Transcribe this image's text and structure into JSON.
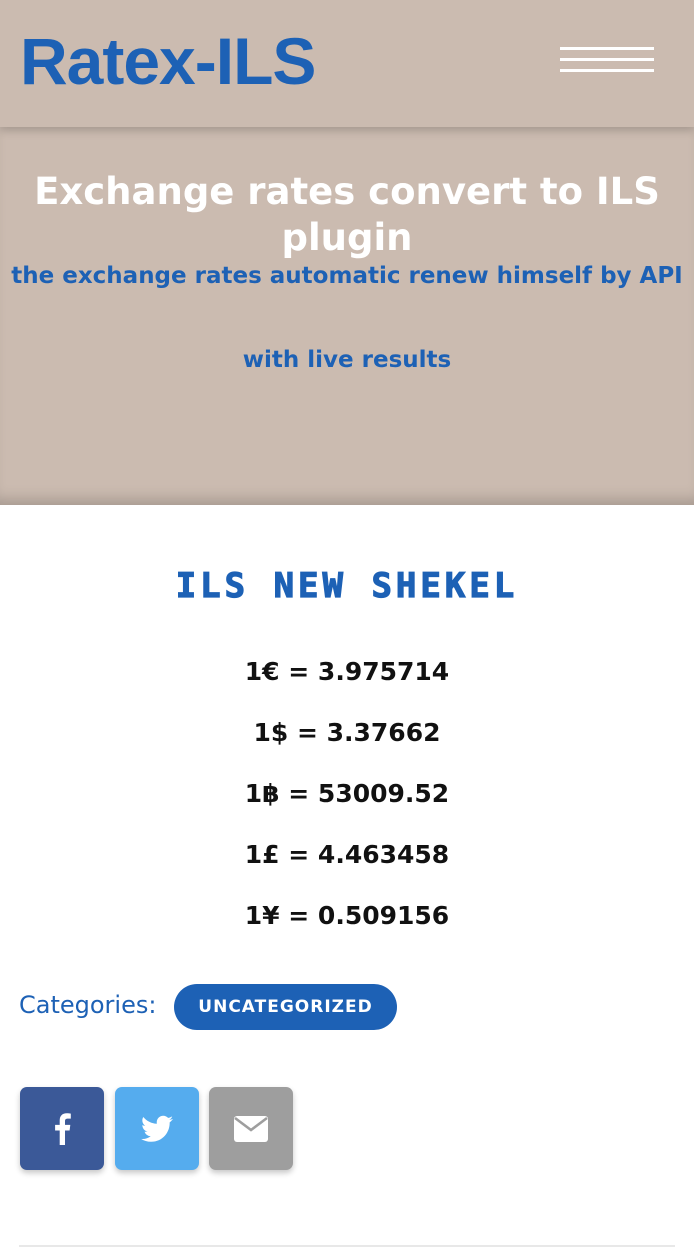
{
  "header": {
    "site_title": "Ratex-ILS",
    "menu_icon": "hamburger-menu-icon"
  },
  "hero": {
    "title": "Exchange rates convert to ILS plugin",
    "subtitle_line1": "the exchange rates automatic renew himself by API",
    "subtitle_line2": "with live results"
  },
  "entry": {
    "heading": "ILS new shekel",
    "rates": [
      "1€ = 3.975714",
      "1$ = 3.37662",
      "1฿ = 53009.52",
      "1£ = 4.463458",
      "1¥ = 0.509156"
    ]
  },
  "meta": {
    "categories_label": "Categories:",
    "category": "Uncategorized"
  },
  "share": {
    "buttons": [
      {
        "icon": "facebook-icon",
        "color": "#3b5998"
      },
      {
        "icon": "twitter-icon",
        "color": "#55acee"
      },
      {
        "icon": "envelope-icon",
        "color": "#9e9e9e"
      }
    ]
  },
  "colors": {
    "accent": "#1d61b5",
    "header_bg": "#cbbbb0"
  }
}
